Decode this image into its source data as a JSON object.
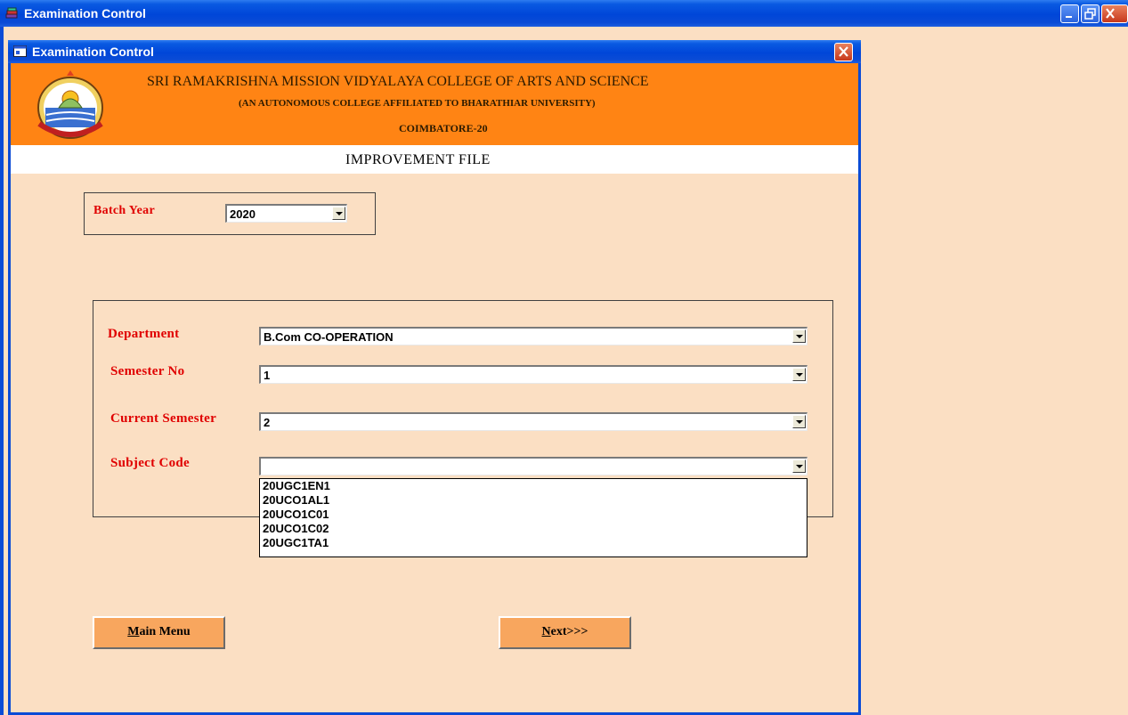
{
  "app": {
    "outer_title": "Examination Control",
    "inner_title": "Examination Control"
  },
  "header": {
    "college_name": "SRI RAMAKRISHNA MISSION VIDYALAYA COLLEGE OF ARTS AND SCIENCE",
    "affiliation": "(AN AUTONOMOUS COLLEGE AFFILIATED TO BHARATHIAR UNIVERSITY)",
    "city": "COIMBATORE-20",
    "page_heading": "IMPROVEMENT FILE"
  },
  "batch": {
    "label": "Batch Year",
    "value": "2020"
  },
  "form": {
    "department_label": "Department",
    "department_value": "B.Com CO-OPERATION",
    "semester_label": "Semester No",
    "semester_value": "1",
    "current_semester_label": "Current Semester",
    "current_semester_value": "2",
    "subject_code_label": "Subject Code",
    "subject_code_value": "",
    "subject_code_options": [
      "20UGC1EN1",
      "20UCO1AL1",
      "20UCO1C01",
      "20UCO1C02",
      "20UGC1TA1"
    ]
  },
  "buttons": {
    "main_menu_rest": "ain Menu",
    "main_menu_key": "M",
    "next_rest": "ext>>>",
    "next_key": "N"
  },
  "icons": {
    "outer_app": "book-stack-icon",
    "inner_app": "window-app-icon",
    "seal": "college-seal-icon"
  },
  "colors": {
    "title_blue": "#0a4bd6",
    "banner_orange": "#ff8414",
    "background": "#fbdfc3",
    "label_red": "#e00000",
    "button_orange": "#f8a65e"
  }
}
